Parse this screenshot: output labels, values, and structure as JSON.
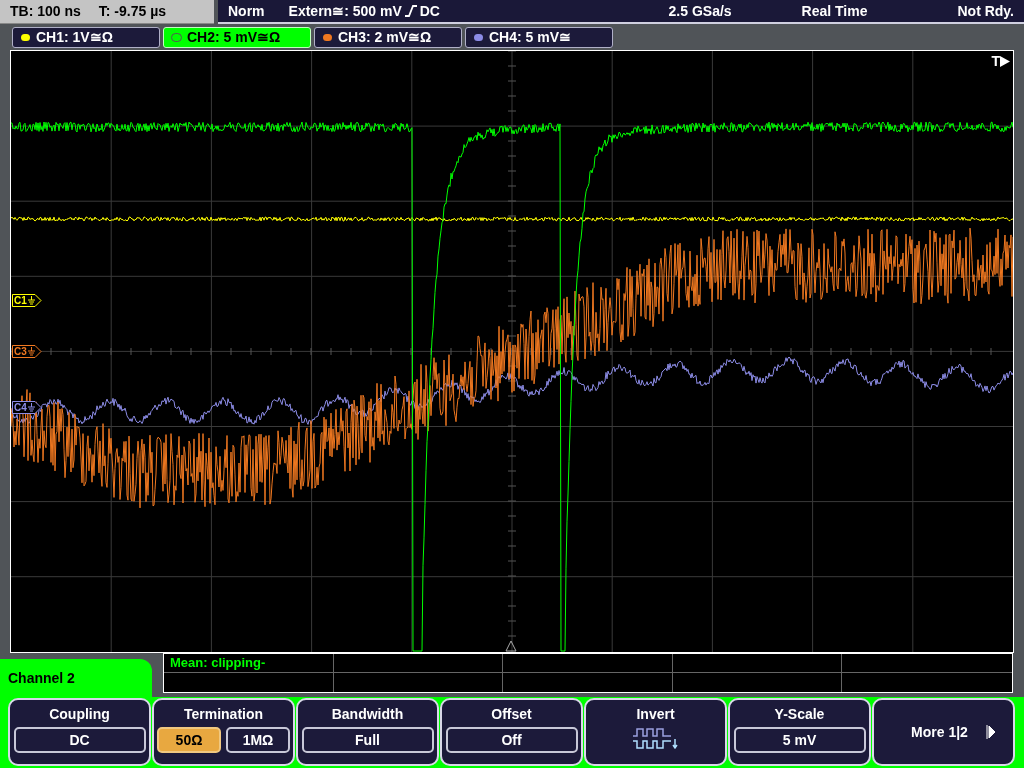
{
  "top_bar": {
    "timebase": "TB: 100 ns",
    "trigger_time": "T: -9.75 µs",
    "mode": "Norm",
    "trigger_source": "Extern≅: 500 mV",
    "trigger_coupling": "DC",
    "sample_rate": "2.5 GSa/s",
    "acquisition": "Real Time",
    "status": "Not Rdy."
  },
  "channels": [
    {
      "label": "CH1: 1V≅Ω",
      "color": "#ffff00",
      "selected": false,
      "marker": "C1"
    },
    {
      "label": "CH2: 5 mV≅Ω",
      "color": "#00ff00",
      "selected": true
    },
    {
      "label": "CH3: 2 mV≅Ω",
      "color": "#f07820",
      "selected": false,
      "marker": "C3"
    },
    {
      "label": "CH4: 5 mV≅",
      "color": "#8c8ce6",
      "selected": false,
      "marker": "C4"
    }
  ],
  "trigger_marker": "T",
  "menu_title": "Channel 2",
  "measurement": "Mean: clipping-",
  "softkeys": [
    {
      "kind": "value",
      "label": "Coupling",
      "value": "DC"
    },
    {
      "kind": "toggle",
      "label": "Termination",
      "options": [
        {
          "text": "50Ω",
          "selected": true
        },
        {
          "text": "1MΩ",
          "selected": false
        }
      ]
    },
    {
      "kind": "value",
      "label": "Bandwidth",
      "value": "Full"
    },
    {
      "kind": "value",
      "label": "Offset",
      "value": "Off"
    },
    {
      "kind": "icon",
      "label": "Invert"
    },
    {
      "kind": "value",
      "label": "Y-Scale",
      "value": "5 mV"
    },
    {
      "kind": "next",
      "label": "More 1|2"
    }
  ]
}
